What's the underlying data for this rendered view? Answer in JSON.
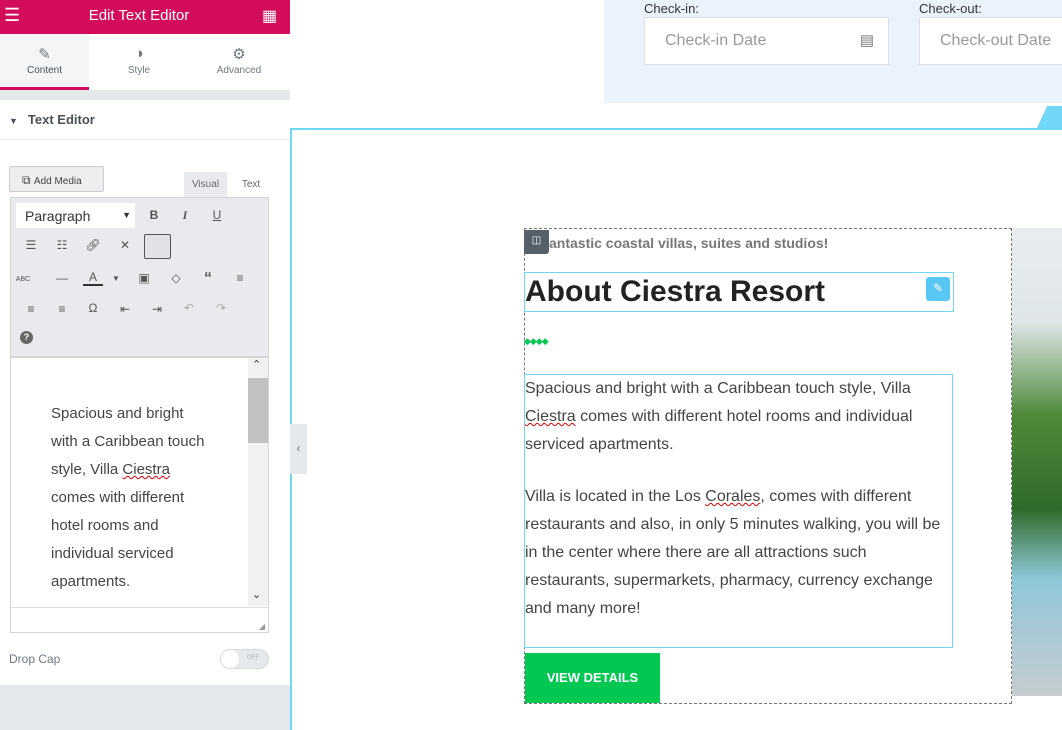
{
  "panel": {
    "title": "Edit Text Editor",
    "tabs": [
      {
        "label": "Content",
        "icon": "pencil-icon"
      },
      {
        "label": "Style",
        "icon": "contrast-icon"
      },
      {
        "label": "Advanced",
        "icon": "gear-icon"
      }
    ],
    "section_title": "Text Editor",
    "add_media": "Add Media",
    "mode_tabs": [
      "Visual",
      "Text"
    ],
    "format_select": "Paragraph",
    "editor_text_before": "Spacious and bright with a Caribbean touch style, Villa ",
    "editor_text_misspelled": "Ciestra",
    "editor_text_after": " comes with different hotel rooms and individual serviced apartments.",
    "drop_cap_label": "Drop Cap",
    "drop_cap_toggle": "OFF"
  },
  "booking": {
    "checkin_label": "Check-in:",
    "checkout_label": "Check-out:",
    "checkin_placeholder": "Check-in Date",
    "checkout_placeholder": "Check-out Date"
  },
  "content": {
    "subtitle": "antastic coastal villas, suites and studios!",
    "heading": "About Ciestra Resort",
    "p1_before": "Spacious and bright with a Caribbean touch style, Villa ",
    "p1_misspelled": "Ciestra",
    "p1_after": " comes with different hotel rooms and individual serviced apartments.",
    "p2_before": "Villa is located in the Los ",
    "p2_misspelled": "Corales",
    "p2_after": ", comes with different restaurants and also, in only 5 minutes walking, you will be in the center where there are all attractions such restaurants, supermarkets, pharmacy, currency exchange and many more!",
    "button": "VIEW DETAILS"
  },
  "colors": {
    "brand": "#d30c5c",
    "accent": "#71d7f7",
    "button": "#00c853"
  }
}
